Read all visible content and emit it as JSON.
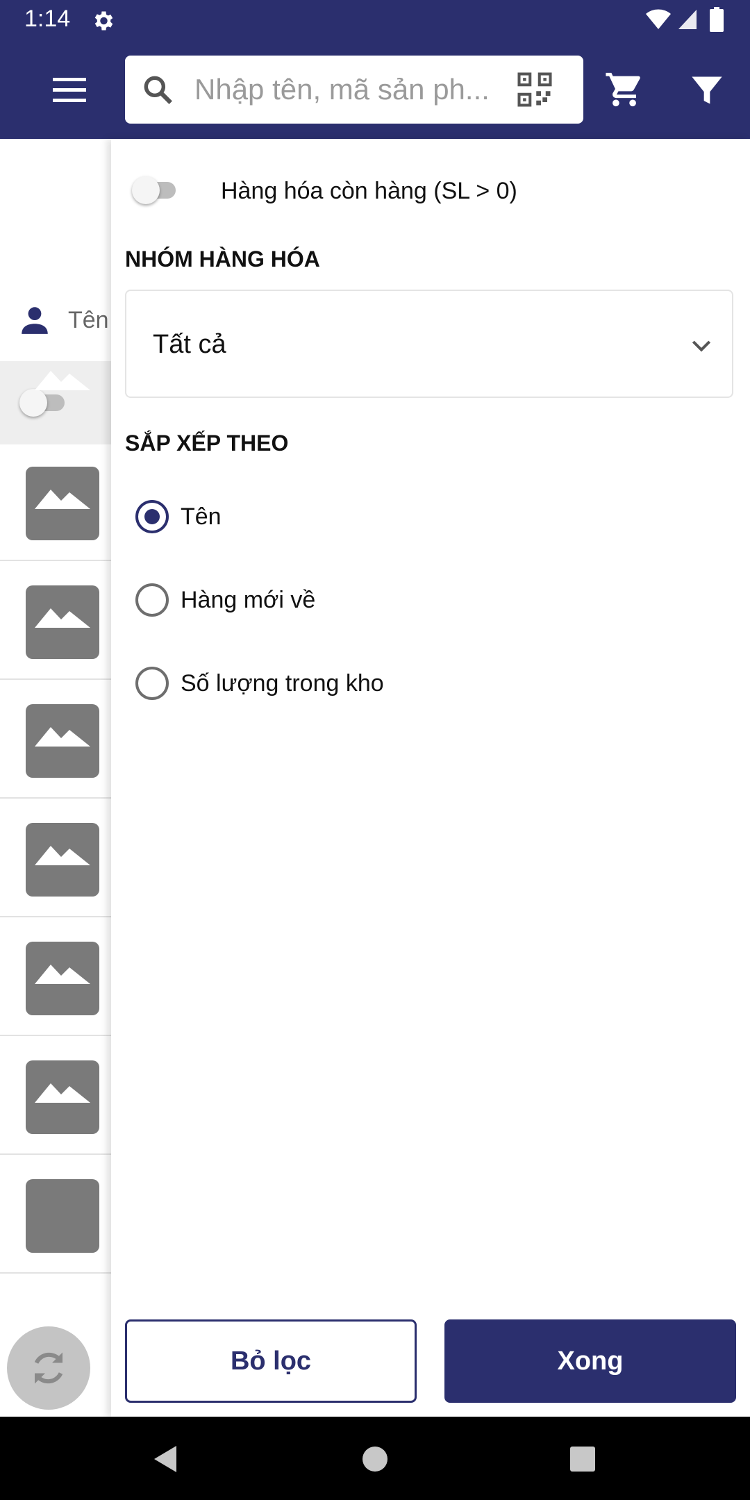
{
  "status_bar": {
    "time": "1:14"
  },
  "app_bar": {
    "search": {
      "placeholder": "Nhập tên, mã sản ph..."
    }
  },
  "background": {
    "user_label": "Tên"
  },
  "drawer": {
    "in_stock_toggle": {
      "label": "Hàng hóa còn hàng (SL > 0)",
      "on": false
    },
    "group_section": {
      "title": "NHÓM HÀNG HÓA",
      "selected": "Tất cả"
    },
    "sort_section": {
      "title": "SẮP XẾP THEO",
      "options": [
        {
          "label": "Tên",
          "selected": true
        },
        {
          "label": "Hàng mới về",
          "selected": false
        },
        {
          "label": "Số lượng trong kho",
          "selected": false
        }
      ]
    },
    "buttons": {
      "clear": "Bỏ lọc",
      "done": "Xong"
    }
  },
  "colors": {
    "primary": "#2b2f6e",
    "placeholder": "#9a9a9a"
  }
}
